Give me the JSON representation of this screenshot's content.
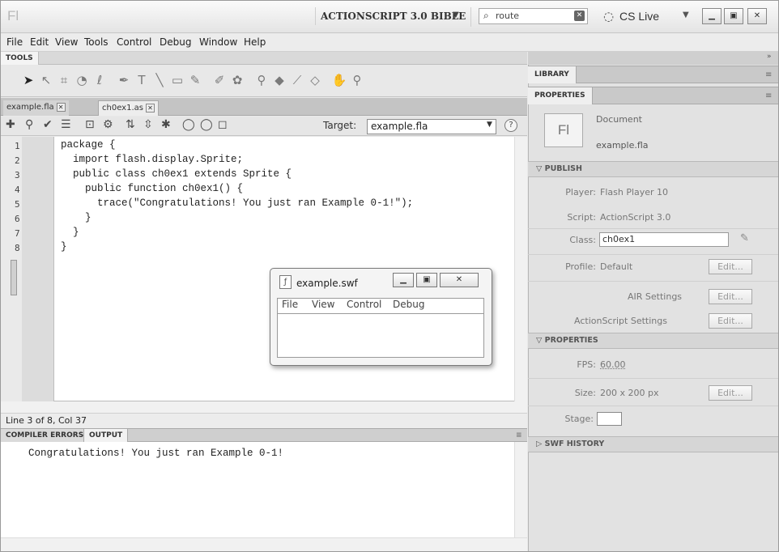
{
  "app": {
    "logo": "Fl",
    "workspace": "ACTIONSCRIPT 3.0 BIBLE",
    "search_value": "route",
    "cs_live": "CS Live"
  },
  "menu": [
    "File",
    "Edit",
    "View",
    "Tools",
    "Control",
    "Debug",
    "Window",
    "Help"
  ],
  "tools_panel": {
    "title": "TOOLS"
  },
  "doc_tabs": [
    {
      "label": "example.fla"
    },
    {
      "label": "ch0ex1.as"
    }
  ],
  "script_toolbar": {
    "target_label": "Target:",
    "target_value": "example.fla"
  },
  "editor": {
    "line_numbers": [
      "1",
      "2",
      "3",
      "4",
      "5",
      "6",
      "7",
      "8"
    ],
    "lines": [
      "package {",
      "  import flash.display.Sprite;",
      "  public class ch0ex1 extends Sprite {",
      "    public function ch0ex1() {",
      "      trace(\"Congratulations! You just ran Example 0-1!\");",
      "    }",
      "  }",
      "}"
    ],
    "status": "Line 3 of 8, Col 37"
  },
  "output_panel": {
    "tabs": [
      "COMPILER ERRORS",
      "OUTPUT"
    ],
    "text": "Congratulations! You just ran Example 0-1!"
  },
  "swf_window": {
    "title": "example.swf",
    "menu": [
      "File",
      "View",
      "Control",
      "Debug"
    ]
  },
  "right_panels": {
    "library_tab": "LIBRARY",
    "properties_tab": "PROPERTIES",
    "doc_icon": "Fl",
    "doc_label": "Document",
    "doc_file": "example.fla",
    "publish": {
      "title": "PUBLISH",
      "player_label": "Player:",
      "player_value": "Flash Player 10",
      "script_label": "Script:",
      "script_value": "ActionScript 3.0",
      "class_label": "Class:",
      "class_value": "ch0ex1",
      "profile_label": "Profile:",
      "profile_value": "Default",
      "edit": "Edit...",
      "air_settings": "AIR Settings",
      "as_settings": "ActionScript Settings"
    },
    "properties": {
      "title": "PROPERTIES",
      "fps_label": "FPS:",
      "fps_value": "60.00",
      "size_label": "Size:",
      "size_value": "200 x 200 px",
      "stage_label": "Stage:",
      "stage_color": "#ffffff"
    },
    "swf_history": {
      "title": "SWF HISTORY"
    }
  }
}
